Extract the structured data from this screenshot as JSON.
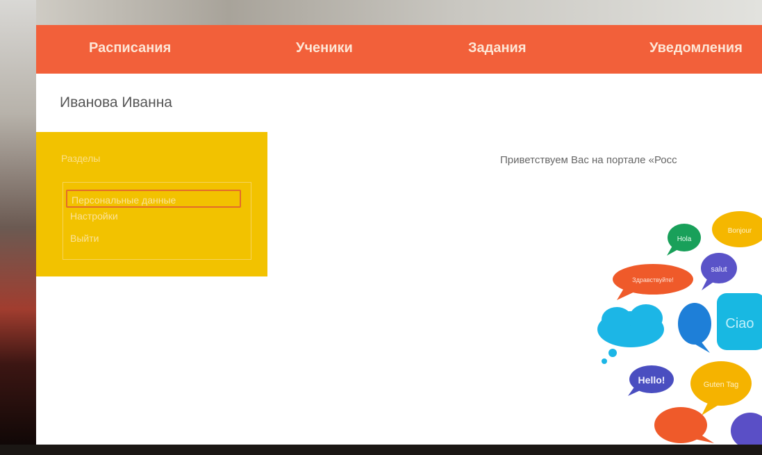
{
  "nav": {
    "items": [
      {
        "label": "Расписания"
      },
      {
        "label": "Ученики"
      },
      {
        "label": "Задания"
      },
      {
        "label": "Уведомления"
      }
    ]
  },
  "user": {
    "name": "Иванова Иванна"
  },
  "panel": {
    "title": "Разделы",
    "items": [
      {
        "label": "Персональные данные"
      },
      {
        "label": "Настройки"
      },
      {
        "label": "Выйти"
      }
    ]
  },
  "main": {
    "welcome": "Приветствуем Вас на портале «Росс"
  },
  "illustration": {
    "greetings": [
      "Hello!",
      "Здравствуйте!",
      "Hola",
      "salut",
      "Bonjour",
      "Ciao",
      "Guten Tag"
    ]
  },
  "colors": {
    "nav_bg": "#f2603a",
    "panel_bg": "#f2c200",
    "active_border": "#e46a2b"
  }
}
